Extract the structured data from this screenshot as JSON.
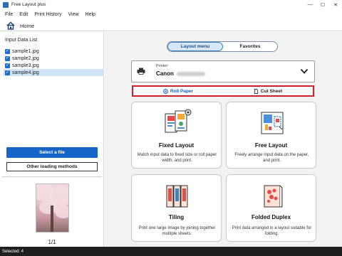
{
  "window": {
    "title": "Free Layout plus",
    "controls": [
      "—",
      "☐",
      "✕"
    ]
  },
  "menu": [
    "File",
    "Edit",
    "Print History",
    "View",
    "Help"
  ],
  "home": {
    "label": "Home"
  },
  "input_list": {
    "title": "Input Data List",
    "items": [
      {
        "name": "sample1.jpg",
        "checked": true,
        "selected": false
      },
      {
        "name": "sample2.jpg",
        "checked": true,
        "selected": false
      },
      {
        "name": "sample3.jpg",
        "checked": true,
        "selected": false
      },
      {
        "name": "sample4.jpg",
        "checked": true,
        "selected": true
      }
    ],
    "select_file_label": "Select a file",
    "other_methods_label": "Other loading methods",
    "page_count": "1/1"
  },
  "tabs": {
    "layout_menu": "Layout menu",
    "favorites": "Favorites",
    "active": "layout_menu"
  },
  "printer": {
    "label": "Printer:",
    "name": "Canon"
  },
  "paper_mode": {
    "roll_paper": "Roll Paper",
    "cut_sheet": "Cut Sheet",
    "active": "roll_paper"
  },
  "cards": {
    "fixed_layout": {
      "title": "Fixed Layout",
      "desc": "Match input data to fixed size or roll paper width, and print."
    },
    "free_layout": {
      "title": "Free Layout",
      "desc": "Freely arrange input data on the paper, and print."
    },
    "tiling": {
      "title": "Tiling",
      "desc": "Print one large image by joining together multiple sheets."
    },
    "folded_duplex": {
      "title": "Folded Duplex",
      "desc": "Print data arranged in a layout suitable for folding."
    }
  },
  "status": {
    "text": "Selected: 4"
  },
  "colors": {
    "accent": "#1565c8",
    "highlight_border": "#d11f2e",
    "selected_row": "#cfe4f7",
    "status_bg": "#1f1f1f"
  }
}
